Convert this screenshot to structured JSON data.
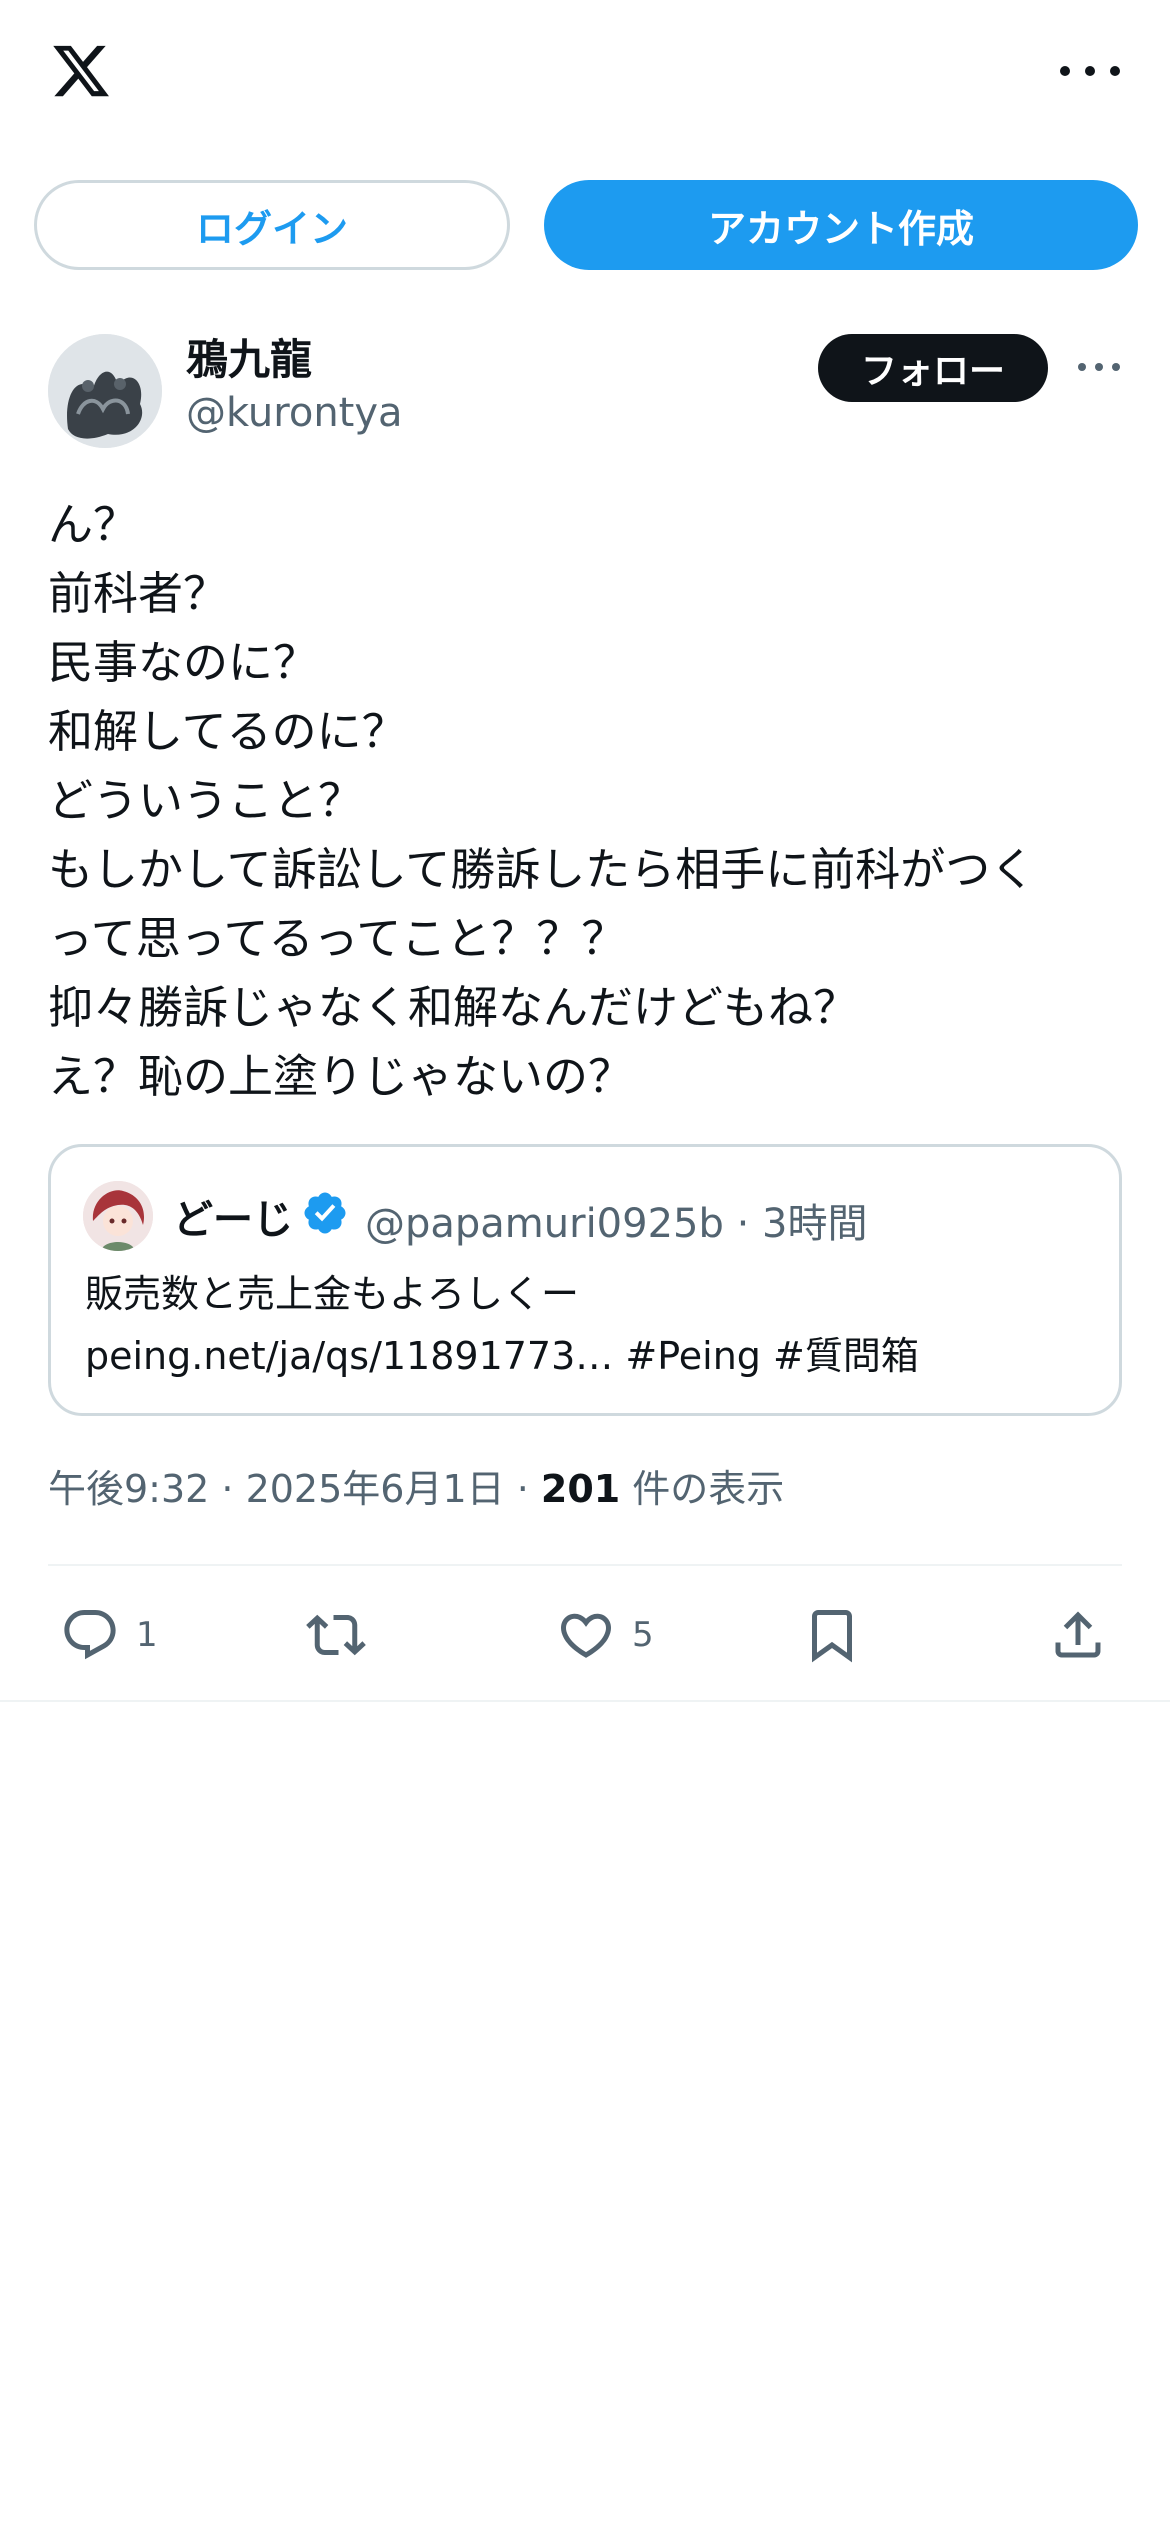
{
  "header": {
    "logo_icon": "x-logo-icon",
    "more_icon": "more-horizontal-icon"
  },
  "auth": {
    "login_label": "ログイン",
    "signup_label": "アカウント作成"
  },
  "author": {
    "name": "鴉九龍",
    "handle": "@kurontya",
    "follow_label": "フォロー"
  },
  "tweet": {
    "lines": [
      "ん？",
      "前科者？",
      "民事なのに？",
      "和解してるのに？",
      "どういうこと？",
      "もしかして訴訟して勝訴したら相手に前科がつく",
      "って思ってるってこと？？？",
      "抑々勝訴じゃなく和解なんだけどもね？",
      "え？恥の上塗りじゃないの？"
    ]
  },
  "quote": {
    "name": "どーじ",
    "meta": "@papamuri0925b · 3時間",
    "line1": "販売数と売上金もよろしくー",
    "line2": "peing.net/ja/qs/11891773… #Peing #質問箱"
  },
  "meta": {
    "time_date": "午後9:32 · 2025年6月1日 · ",
    "views_count": "201",
    "views_label": " 件の表示"
  },
  "actions": {
    "reply_count": "1",
    "like_count": "5"
  },
  "colors": {
    "accent": "#1d9bf0",
    "text": "#0f1419",
    "secondary": "#536471",
    "border": "#cfd9de"
  }
}
